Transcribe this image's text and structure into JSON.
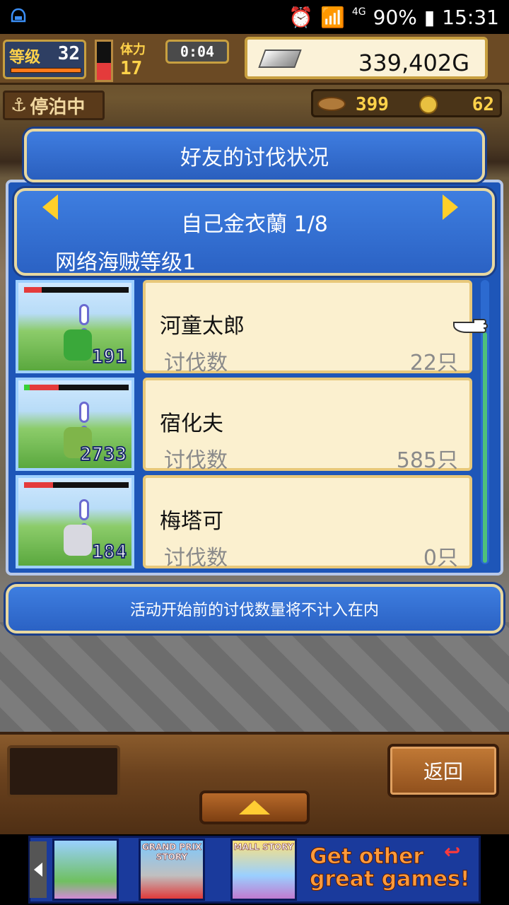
{
  "status_bar": {
    "battery_percent": "90%",
    "time": "15:31",
    "network": "4G"
  },
  "hud": {
    "level_label": "等级",
    "level_value": "32",
    "stamina_label": "体力",
    "stamina_value": "17",
    "timer": "0:04",
    "gold": "339,402G",
    "docked_label": "停泊中",
    "resource_1": "399",
    "resource_2": "62"
  },
  "dialog": {
    "title": "好友的讨伐状况",
    "friend_name": "自己金衣蘭 1/8",
    "friend_rank": "网络海贼等级1",
    "note": "活动开始前的讨伐数量将不计入在内"
  },
  "monsters": [
    {
      "name": "河童太郎",
      "count_label": "讨伐数",
      "count": "22只",
      "badge": "191",
      "hp_fraction": 0.17,
      "color": "#3aa83a"
    },
    {
      "name": "宿化夫",
      "count_label": "讨伐数",
      "count": "585只",
      "badge": "2733",
      "hp_fraction": 0.28,
      "color": "#7fb54a"
    },
    {
      "name": "梅塔可",
      "count_label": "讨伐数",
      "count": "0只",
      "badge": "184",
      "hp_fraction": 0.28,
      "color": "#d8d8e0"
    }
  ],
  "buttons": {
    "back": "返回"
  },
  "ad": {
    "tile_1": "",
    "tile_2": "GRAND PRIX STORY",
    "tile_3": "MALL STORY",
    "promo": "Get other great games!"
  }
}
